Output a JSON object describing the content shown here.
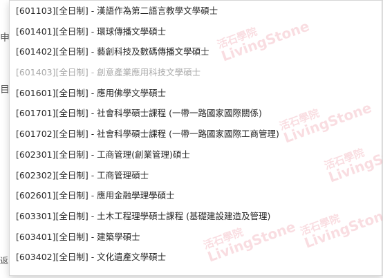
{
  "background": {
    "frag_1": "申",
    "frag_2": "目",
    "frag_3": "返"
  },
  "dropdown": {
    "options": [
      {
        "label": "[601103][全日制] - 漢語作為第二語言教學文學碩士",
        "disabled": false
      },
      {
        "label": "[601401][全日制] - 環球傳播文學碩士",
        "disabled": false
      },
      {
        "label": "[601402][全日制] - 藝創科技及數碼傳播文學碩士",
        "disabled": false
      },
      {
        "label": "[601403][全日制] - 創意產業應用科技文學碩士",
        "disabled": true
      },
      {
        "label": "[601601][全日制] - 應用佛學文學碩士",
        "disabled": false
      },
      {
        "label": "[601701][全日制] - 社會科學碩士課程 (一帶一路國家國際關係)",
        "disabled": false
      },
      {
        "label": "[601702][全日制] - 社會科學碩士課程 (一帶一路國家國際工商管理)",
        "disabled": false
      },
      {
        "label": "[602301][全日制] - 工商管理(創業管理)碩士",
        "disabled": false
      },
      {
        "label": "[602302][全日制] - 工商管理碩士",
        "disabled": false
      },
      {
        "label": "[602601][全日制] - 應用金融學理學碩士",
        "disabled": false
      },
      {
        "label": "[603301][全日制] - 土木工程理學碩士課程 (基礎建設建造及管理)",
        "disabled": false
      },
      {
        "label": "[603401][全日制] - 建築學碩士",
        "disabled": false
      },
      {
        "label": "[603402][全日制] - 文化遺產文學碩士",
        "disabled": false
      }
    ]
  },
  "watermark": {
    "cn": "活石學院",
    "en": "LivingStone",
    "sub": "Academy"
  }
}
